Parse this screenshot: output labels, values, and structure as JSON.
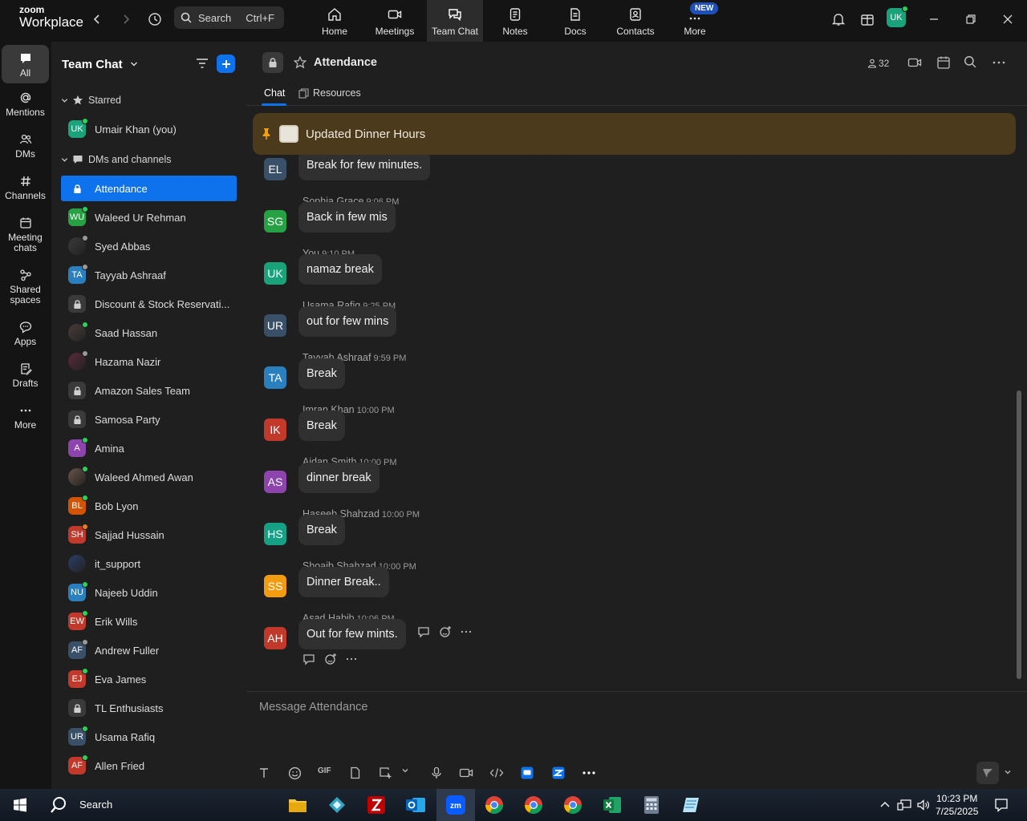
{
  "app": {
    "logo_line1": "zoom",
    "logo_line2": "Workplace",
    "search_label": "Search",
    "search_shortcut": "Ctrl+F",
    "new_badge": "NEW",
    "user_initials": "UK"
  },
  "nav": {
    "items": [
      {
        "label": "Home"
      },
      {
        "label": "Meetings"
      },
      {
        "label": "Team Chat"
      },
      {
        "label": "Notes"
      },
      {
        "label": "Docs"
      },
      {
        "label": "Contacts"
      },
      {
        "label": "More"
      }
    ]
  },
  "rail": {
    "items": [
      {
        "label": "All"
      },
      {
        "label": "Mentions"
      },
      {
        "label": "DMs"
      },
      {
        "label": "Channels"
      },
      {
        "label": "Meeting chats"
      },
      {
        "label": "Shared spaces"
      },
      {
        "label": "Apps"
      },
      {
        "label": "Drafts"
      },
      {
        "label": "More"
      }
    ]
  },
  "sidebar": {
    "title": "Team Chat",
    "starred_label": "Starred",
    "starred": [
      {
        "name": "Umair Khan (you)",
        "initials": "UK",
        "color": "#1aa37a",
        "status": "#2ed158"
      }
    ],
    "dms_label": "DMs and channels",
    "items": [
      {
        "name": "Attendance",
        "initials": "",
        "type": "lock",
        "color": "#0e72ed",
        "status": ""
      },
      {
        "name": "Waleed Ur Rehman",
        "initials": "WU",
        "color": "#26a244",
        "status": "#2ed158"
      },
      {
        "name": "Syed Abbas",
        "initials": "",
        "type": "photo",
        "color": "#3a3a3a",
        "status": "#9a9a9a"
      },
      {
        "name": "Tayyab Ashraaf",
        "initials": "TA",
        "color": "#2a7fbf",
        "status": "#9a9a9a"
      },
      {
        "name": "Discount & Stock Reservati...",
        "initials": "",
        "type": "lock",
        "color": "#3a3a3a",
        "status": ""
      },
      {
        "name": "Saad Hassan",
        "initials": "",
        "type": "photo",
        "color": "#4a3d3a",
        "status": "#2ed158"
      },
      {
        "name": "Hazama Nazir",
        "initials": "",
        "type": "photo",
        "color": "#5a2a3a",
        "status": "#9a9a9a"
      },
      {
        "name": "Amazon Sales Team",
        "initials": "",
        "type": "lock",
        "color": "#3a3a3a",
        "status": ""
      },
      {
        "name": "Samosa Party",
        "initials": "",
        "type": "lock",
        "color": "#3a3a3a",
        "status": ""
      },
      {
        "name": "Amina",
        "initials": "A",
        "color": "#8e44ad",
        "status": "#2ed158"
      },
      {
        "name": "Waleed Ahmed Awan",
        "initials": "",
        "type": "photo",
        "color": "#6b5548",
        "status": "#2ed158"
      },
      {
        "name": "Bob Lyon",
        "initials": "BL",
        "color": "#d35400",
        "status": "#2ed158"
      },
      {
        "name": "Sajjad Hussain",
        "initials": "SH",
        "color": "#c0392b",
        "status": "#e67e22"
      },
      {
        "name": "it_support",
        "initials": "",
        "type": "photo",
        "color": "#2c3e66",
        "status": ""
      },
      {
        "name": "Najeeb Uddin",
        "initials": "NU",
        "color": "#2a7fbf",
        "status": "#2ed158"
      },
      {
        "name": "Erik Wills",
        "initials": "EW",
        "color": "#c0392b",
        "status": "#2ed158"
      },
      {
        "name": "Andrew Fuller",
        "initials": "AF",
        "color": "#3a5068",
        "status": "#9a9a9a"
      },
      {
        "name": "Eva James",
        "initials": "EJ",
        "color": "#c0392b",
        "status": "#2ed158"
      },
      {
        "name": "TL Enthusiasts",
        "initials": "",
        "type": "lock",
        "color": "#3a3a3a",
        "status": ""
      },
      {
        "name": "Usama Rafiq",
        "initials": "UR",
        "color": "#3a5068",
        "status": "#2ed158"
      },
      {
        "name": "Allen Fried",
        "initials": "AF",
        "color": "#c0392b",
        "status": "#2ed158"
      }
    ]
  },
  "channel": {
    "name": "Attendance",
    "member_count": "32",
    "tabs": [
      {
        "label": "Chat"
      },
      {
        "label": "Resources"
      }
    ],
    "pinned_text": "Updated Dinner Hours",
    "composer_placeholder": "Message Attendance"
  },
  "messages": [
    {
      "initials": "EL",
      "color": "#3a5068",
      "name": "",
      "time": "",
      "text": "Break for few minutes."
    },
    {
      "initials": "SG",
      "color": "#26a244",
      "name": "Sophia Grace",
      "time": "9:06 PM",
      "text": "Back in few mis"
    },
    {
      "initials": "UK",
      "color": "#1aa37a",
      "name": "You",
      "time": "9:10 PM",
      "text": "namaz break"
    },
    {
      "initials": "UR",
      "color": "#3a5068",
      "name": "Usama Rafiq",
      "time": "9:25 PM",
      "text": "out for few mins"
    },
    {
      "initials": "TA",
      "color": "#2a7fbf",
      "name": "Tayyab Ashraaf",
      "time": "9:59 PM",
      "text": "Break"
    },
    {
      "initials": "IK",
      "color": "#c0392b",
      "name": "Imran Khan",
      "time": "10:00 PM",
      "text": "Break"
    },
    {
      "initials": "AS",
      "color": "#8e44ad",
      "name": "Aidan Smith",
      "time": "10:00 PM",
      "text": "dinner break"
    },
    {
      "initials": "HS",
      "color": "#16a085",
      "name": "Haseeb Shahzad",
      "time": "10:00 PM",
      "text": "Break"
    },
    {
      "initials": "SS",
      "color": "#f39c12",
      "name": "Shoaib Shahzad",
      "time": "10:00 PM",
      "text": "Dinner Break.."
    },
    {
      "initials": "AH",
      "color": "#c0392b",
      "name": "Asad Habib",
      "time": "10:06 PM",
      "text": "Out for few mints."
    }
  ],
  "toolbar": {
    "gif_label": "GIF"
  },
  "taskbar": {
    "search_label": "Search",
    "time": "10:23 PM",
    "date": "7/25/2025"
  }
}
